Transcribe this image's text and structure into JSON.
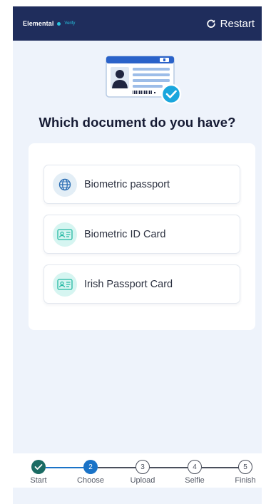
{
  "header": {
    "brand_name": "Elemental",
    "brand_sub": "Verify",
    "restart_label": "Restart",
    "background_color": "#1f2d5c",
    "accent_color": "#27c4e0"
  },
  "illustration": {
    "icon": "id-card-verified-illustration"
  },
  "main": {
    "title": "Which document do you have?",
    "options": [
      {
        "label": "Biometric passport",
        "icon": "globe-icon"
      },
      {
        "label": "Biometric ID Card",
        "icon": "id-card-icon"
      },
      {
        "label": "Irish Passport Card",
        "icon": "id-card-icon"
      }
    ]
  },
  "stepper": {
    "current_step": 2,
    "steps": [
      {
        "label": "Start",
        "number": "1",
        "state": "complete"
      },
      {
        "label": "Choose",
        "number": "2",
        "state": "current"
      },
      {
        "label": "Upload",
        "number": "3",
        "state": "pending"
      },
      {
        "label": "Selfie",
        "number": "4",
        "state": "pending"
      },
      {
        "label": "Finish",
        "number": "5",
        "state": "pending"
      }
    ],
    "complete_color": "#1a6b63",
    "current_color": "#1a73c7"
  }
}
